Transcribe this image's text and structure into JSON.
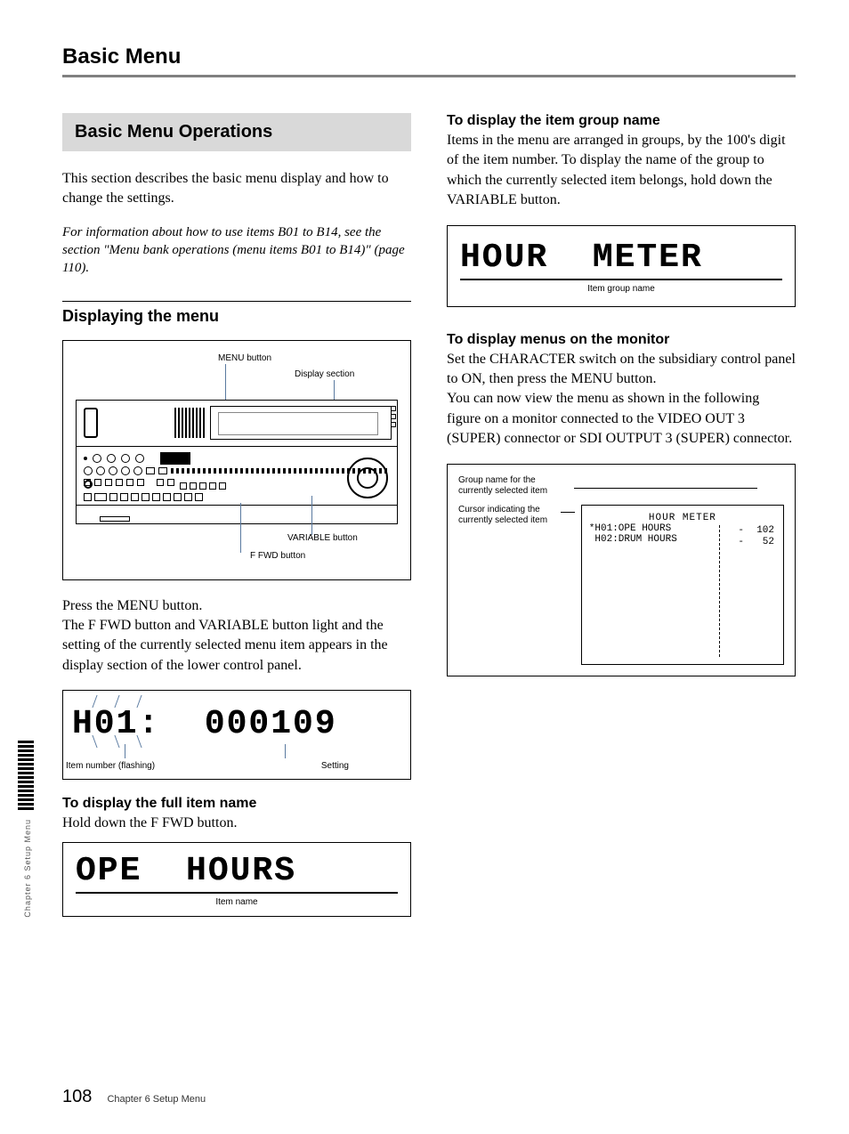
{
  "page": {
    "title": "Basic Menu",
    "number": "108",
    "footer_chapter": "Chapter 6  Setup Menu",
    "side_text": "Chapter 6  Setup Menu"
  },
  "left": {
    "banner": "Basic Menu Operations",
    "intro": "This section describes the basic menu display and how to change the settings.",
    "note": "For information about how to use items B01 to B14, see the section \"Menu bank operations (menu items B01 to B14)\" (page 110).",
    "displaying_heading": "Displaying the menu",
    "vcr_labels": {
      "menu": "MENU button",
      "display": "Display section",
      "variable": "VARIABLE button",
      "ffwd": "F FWD button"
    },
    "after_vcr_para": "Press the MENU button.\nThe F FWD button and VARIABLE button light and the setting of the currently selected menu item appears in the display section of the lower control panel.",
    "itemnum_lcd": "H01:  000109",
    "itemnum_label_left": "Item number (flashing)",
    "itemnum_label_right": "Setting",
    "full_item_heading": "To display the full item name",
    "full_item_body": "Hold down the F FWD button.",
    "ope_lcd": "OPE  HOURS",
    "ope_caption": "Item name"
  },
  "right": {
    "group_heading": "To display the item group name",
    "group_body": "Items in the menu are arranged in groups, by the 100's digit of the item number. To display the name of the group to which the currently selected item belongs, hold down the VARIABLE button.",
    "hour_lcd": "HOUR  METER",
    "hour_caption": "Item group name",
    "monitor_heading": "To display menus on the monitor",
    "monitor_body": "Set the CHARACTER switch on the subsidiary control panel to ON, then press the MENU button.\nYou can now view the menu as shown in the following figure on a monitor connected to the VIDEO OUT 3 (SUPER) connector or SDI OUTPUT 3 (SUPER) connector.",
    "monitor_label_group": "Group name for the currently selected item",
    "monitor_label_cursor": "Cursor indicating the currently selected item",
    "monitor_screen": {
      "title": "HOUR METER",
      "row1_left": "*H01:OPE HOURS",
      "row2_left": " H02:DRUM HOURS",
      "dash": "-",
      "val1": "102",
      "val2": "52"
    }
  }
}
